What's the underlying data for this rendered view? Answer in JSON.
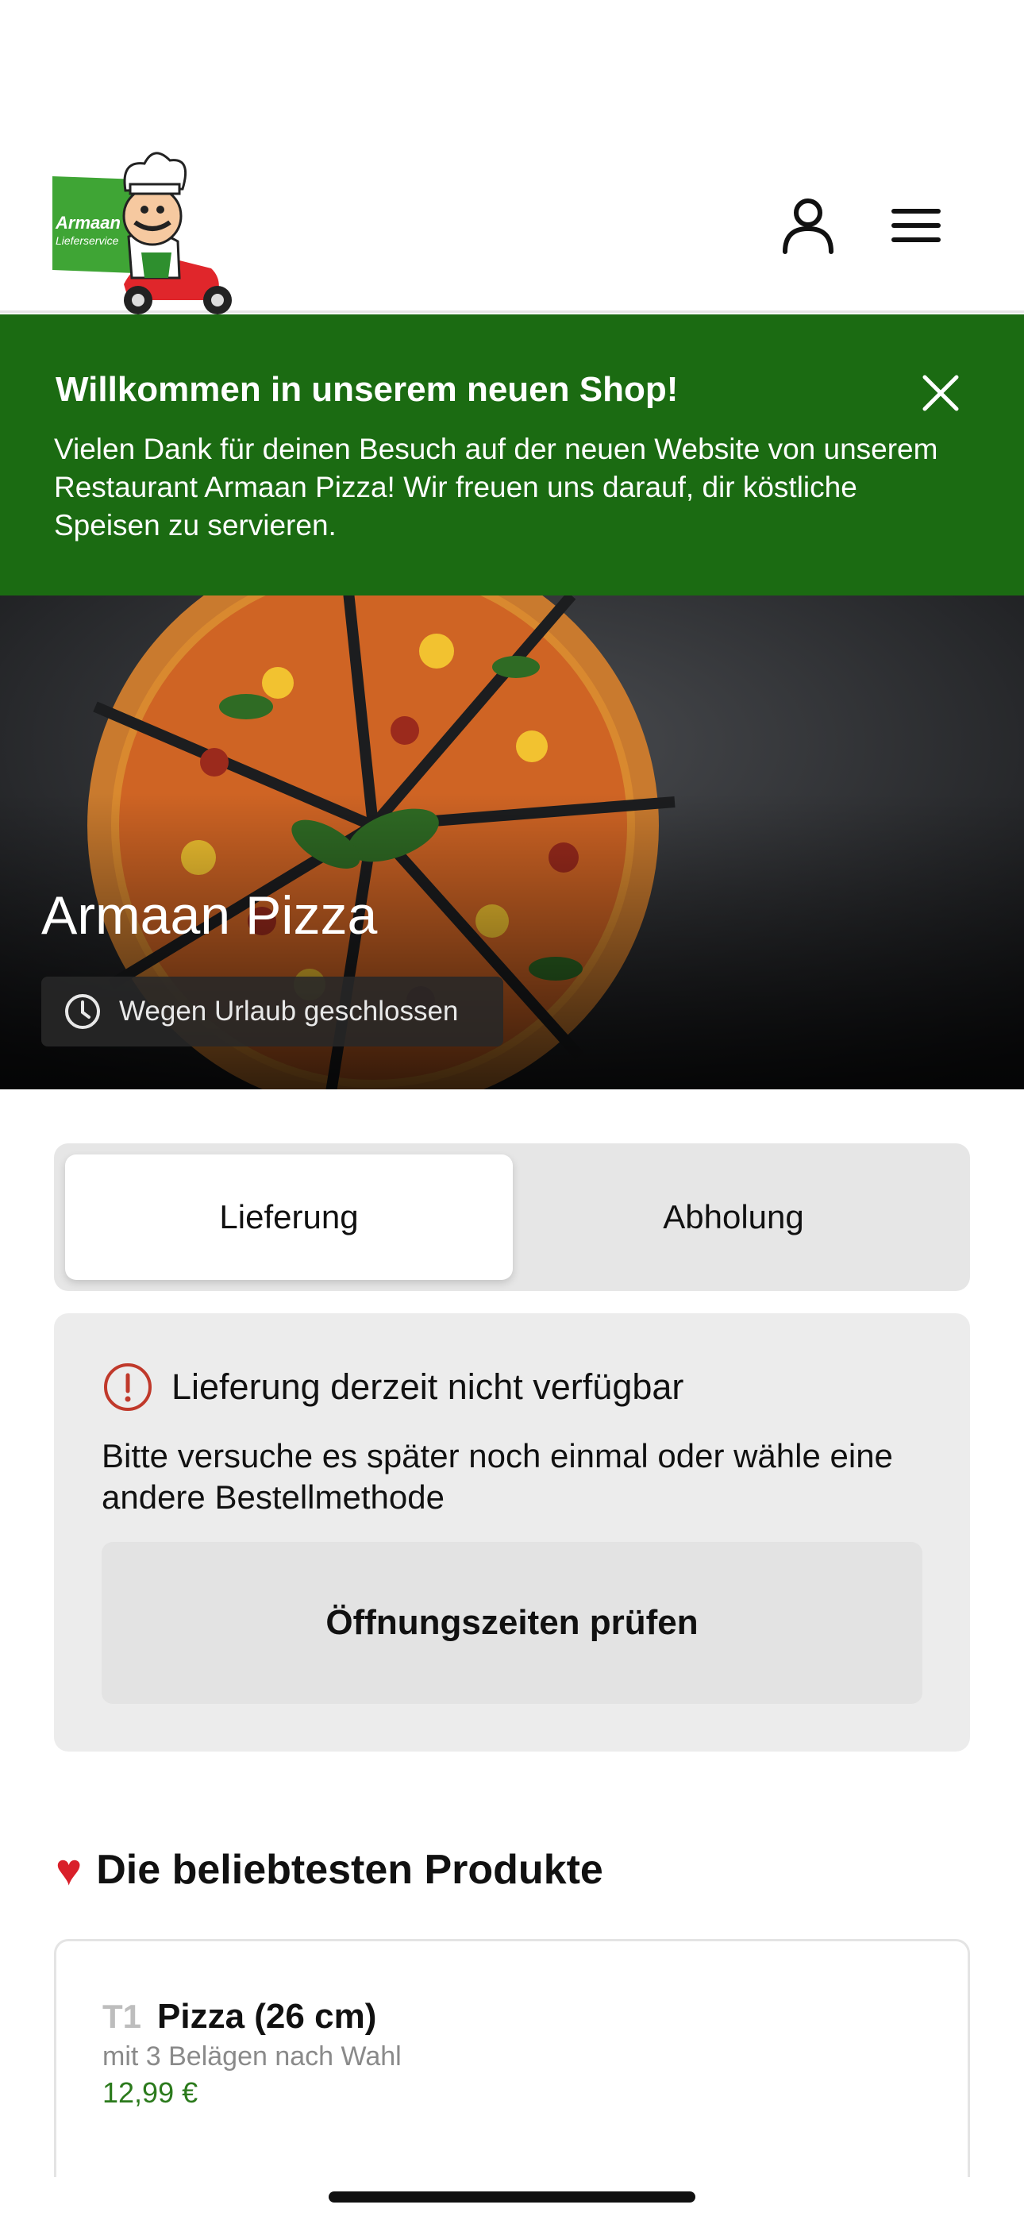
{
  "header": {
    "logo_text": [
      "Armaan",
      "Lieferservice"
    ]
  },
  "banner": {
    "title": "Willkommen in unserem neuen Shop!",
    "text": "Vielen Dank für deinen Besuch auf der neuen Website von unserem Restaurant Armaan Pizza! Wir freuen uns darauf, dir köstliche Speisen zu servieren."
  },
  "hero": {
    "title": "Armaan Pizza",
    "status": "Wegen Urlaub geschlossen"
  },
  "order_method": {
    "options": [
      "Lieferung",
      "Abholung"
    ],
    "selected": "Lieferung"
  },
  "notice": {
    "title": "Lieferung derzeit nicht verfügbar",
    "text": "Bitte versuche es später noch einmal oder wähle eine andere Bestellmethode",
    "button": "Öffnungszeiten prüfen"
  },
  "popular": {
    "title": "Die beliebtesten Produkte",
    "products": [
      {
        "code": "T1",
        "name": "Pizza (26 cm)",
        "description": "mit 3 Belägen nach Wahl",
        "price": "12,99 €"
      }
    ]
  },
  "colors": {
    "brand_green": "#1b6b12",
    "price_green": "#2b7a1c",
    "alert_red": "#c0392b"
  }
}
